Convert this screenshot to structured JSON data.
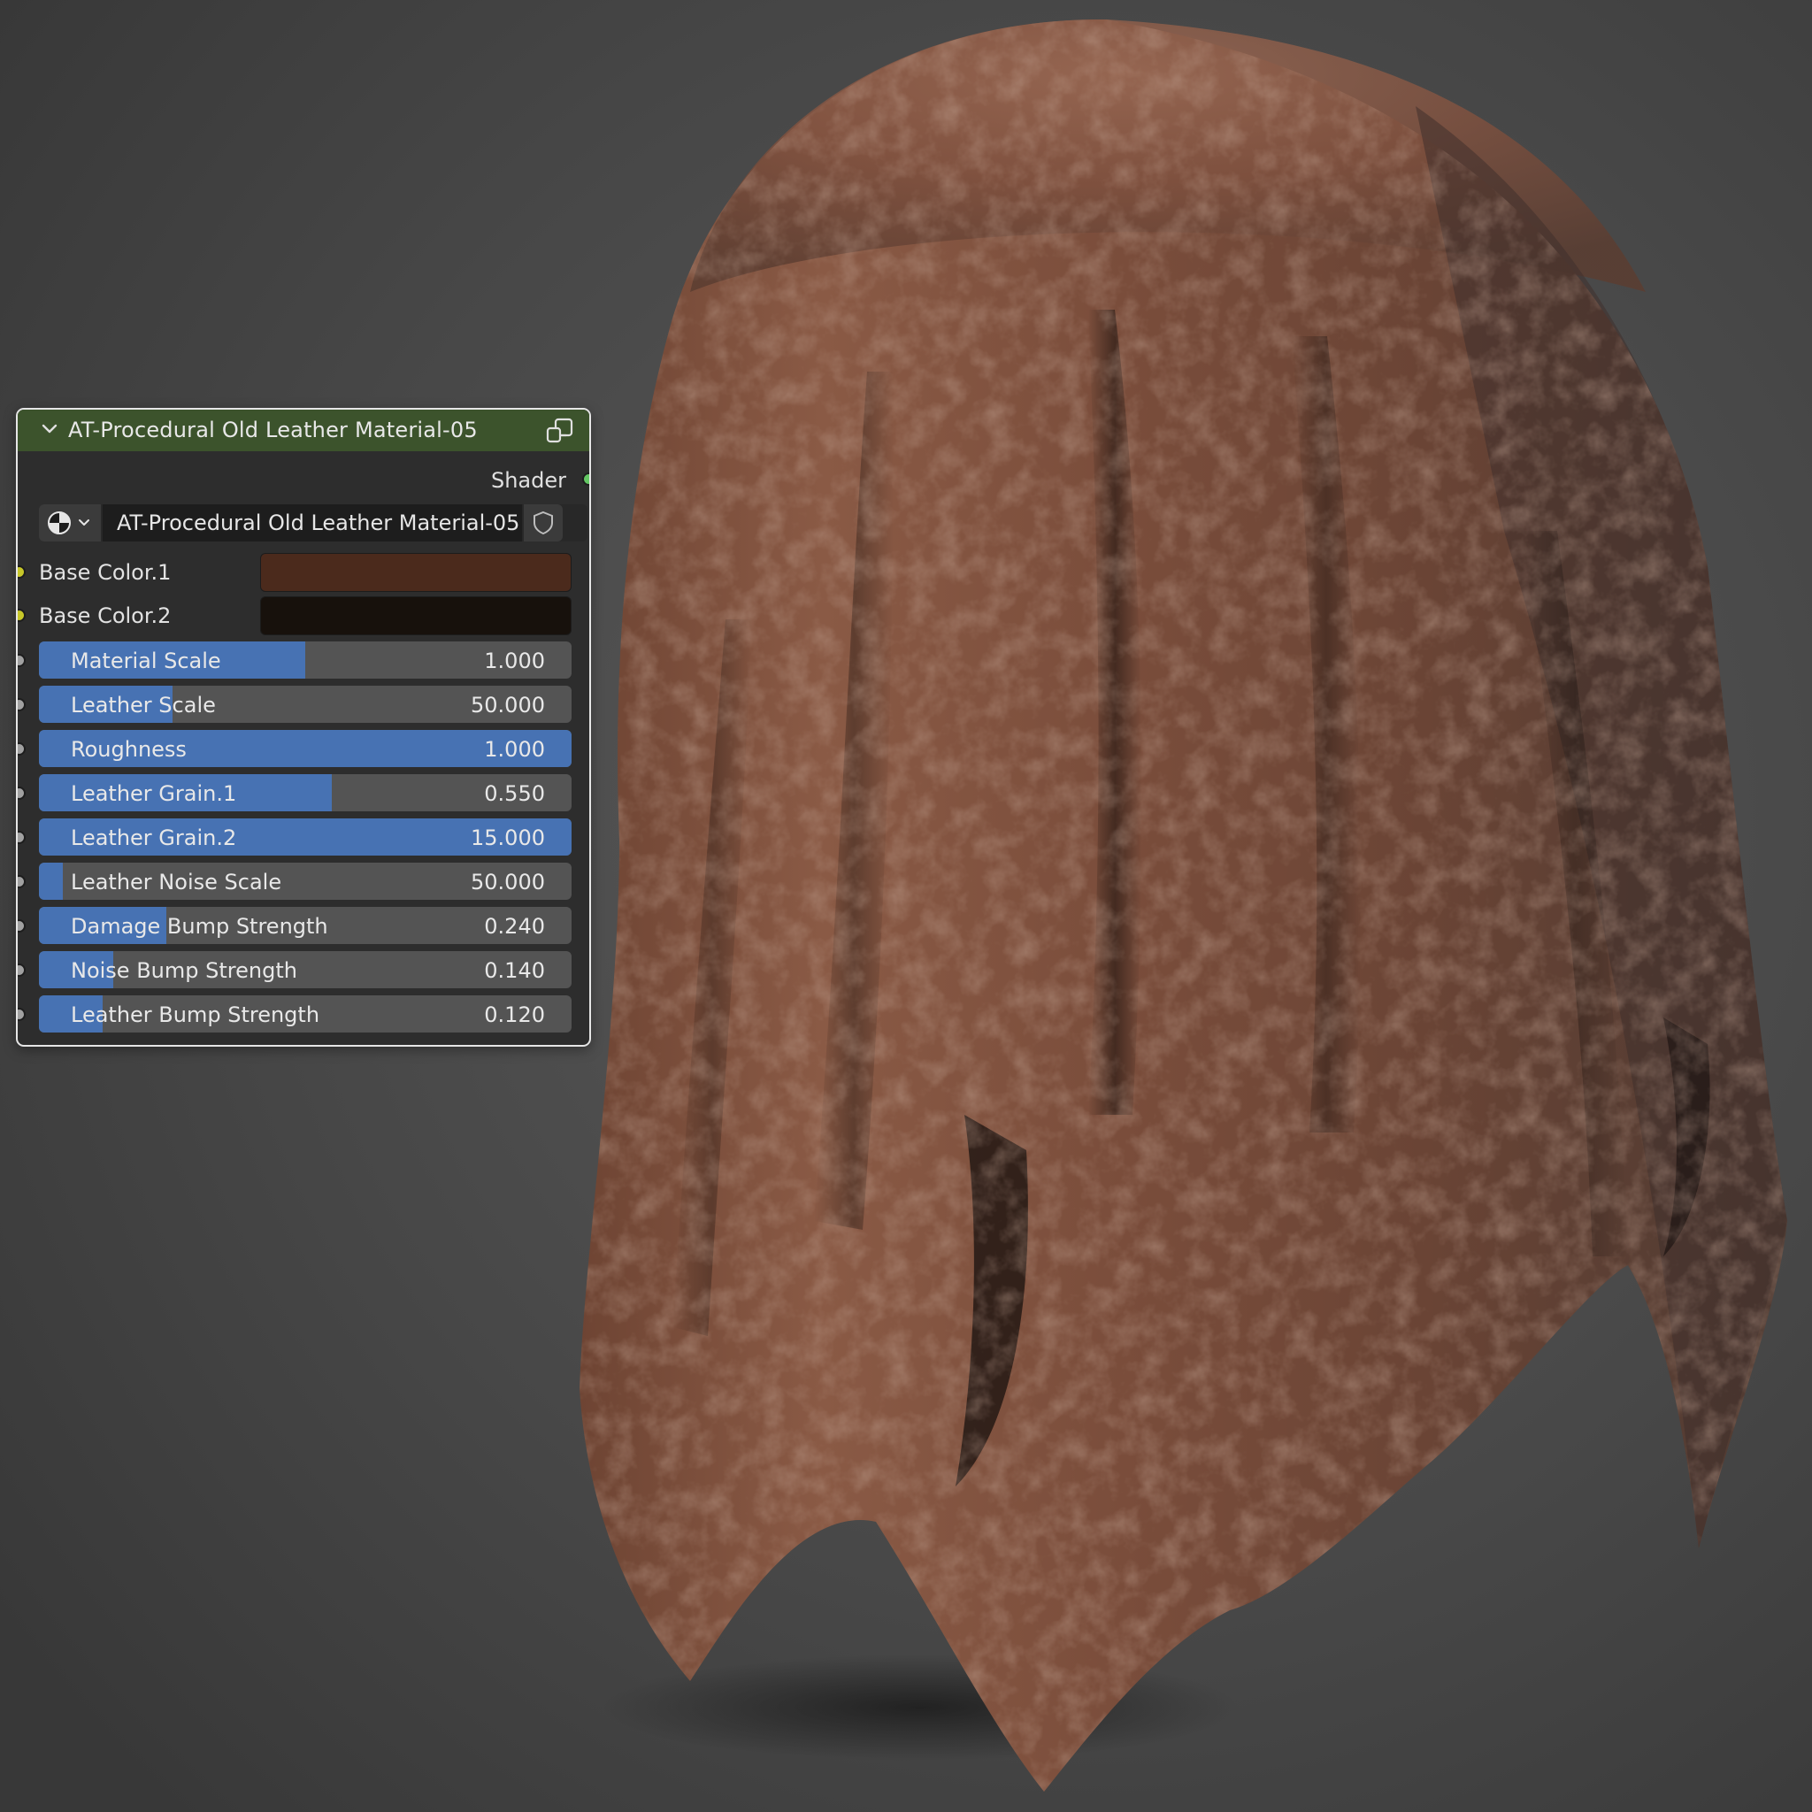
{
  "node": {
    "title": "AT-Procedural Old Leather Material-05",
    "output_label": "Shader",
    "datablock_name": "AT-Procedural Old Leather Material-05",
    "header_color": "#3c532c",
    "colors": [
      {
        "label": "Base Color.1",
        "value": "#4b2a1c"
      },
      {
        "label": "Base Color.2",
        "value": "#17110c"
      }
    ],
    "sliders": [
      {
        "label": "Material Scale",
        "value": "1.000",
        "fill": 0.5
      },
      {
        "label": "Leather Scale",
        "value": "50.000",
        "fill": 0.25
      },
      {
        "label": "Roughness",
        "value": "1.000",
        "fill": 1.0
      },
      {
        "label": "Leather Grain.1",
        "value": "0.550",
        "fill": 0.55
      },
      {
        "label": "Leather Grain.2",
        "value": "15.000",
        "fill": 1.0
      },
      {
        "label": "Leather Noise Scale",
        "value": "50.000",
        "fill": 0.045
      },
      {
        "label": "Damage Bump Strength",
        "value": "0.240",
        "fill": 0.24
      },
      {
        "label": "Noise Bump Strength",
        "value": "0.140",
        "fill": 0.14
      },
      {
        "label": "Leather Bump Strength",
        "value": "0.120",
        "fill": 0.12
      }
    ]
  },
  "theme": {
    "slider_fill": "#4772b3",
    "slider_bg": "#545454",
    "socket_shader": "#63c763",
    "socket_color": "#c7c729",
    "socket_float": "#a1a1a1"
  }
}
